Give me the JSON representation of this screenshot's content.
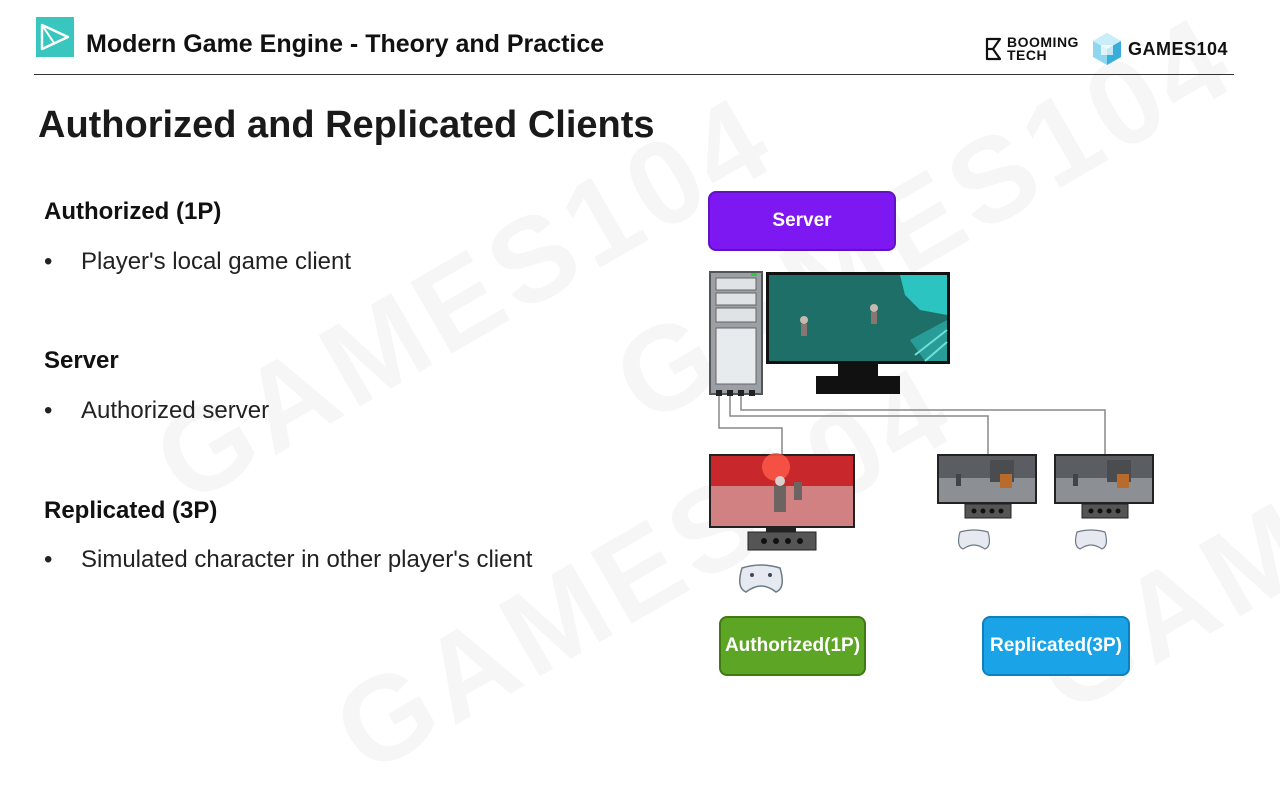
{
  "header": {
    "title": "Modern Game Engine - Theory and Practice",
    "brand_booming": "BOOMING TECH",
    "brand_booming_line1": "BOOMING",
    "brand_booming_line2": "TECH",
    "brand_games": "GAMES104"
  },
  "watermark_text": "GAMES104",
  "slide": {
    "title": "Authorized and Replicated Clients",
    "sections": [
      {
        "heading": "Authorized (1P)",
        "bullet": "Player's local game client"
      },
      {
        "heading": "Server",
        "bullet": "Authorized server"
      },
      {
        "heading": "Replicated (3P)",
        "bullet": "Simulated character in other player's client"
      }
    ],
    "bullet_symbol": "•"
  },
  "diagram": {
    "server_label": "Server",
    "authorized_label": "Authorized(1P)",
    "replicated_label": "Replicated(3P)",
    "colors": {
      "server": "#7d18f2",
      "authorized": "#5da524",
      "replicated": "#1aa3e6",
      "monitor_scene": "#1a6f68",
      "auth_screen": "#c8282b"
    }
  }
}
